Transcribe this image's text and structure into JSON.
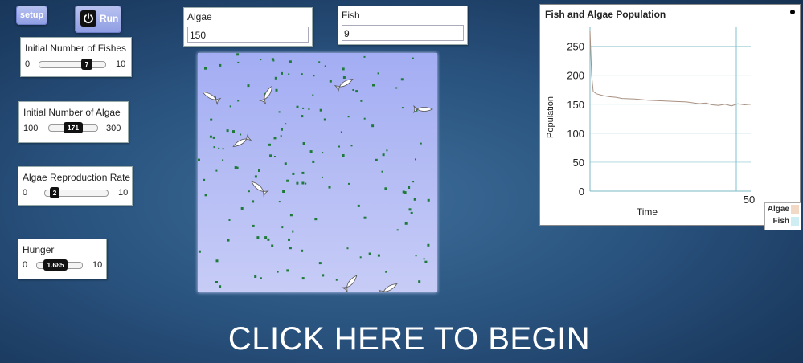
{
  "buttons": {
    "setup": "setup",
    "run": "Run"
  },
  "sliders": [
    {
      "title": "Initial Number of Fishes",
      "min": "0",
      "max": "10",
      "value": "7",
      "fraction": 0.7
    },
    {
      "title": "Initial Number of Algae",
      "min": "100",
      "max": "300",
      "value": "171",
      "fraction": 0.355
    },
    {
      "title": "Algae Reproduction Rate",
      "min": "0",
      "max": "10",
      "value": "2",
      "fraction": 0.2
    },
    {
      "title": "Hunger",
      "min": "0",
      "max": "10",
      "value": "1.685",
      "fraction": 0.1685
    }
  ],
  "monitors": {
    "algae": {
      "label": "Algae",
      "value": "150"
    },
    "fish": {
      "label": "Fish",
      "value": "9"
    }
  },
  "plot": {
    "title": "Fish and Algae Population",
    "ylabel": "Population",
    "xlabel": "Time",
    "yticks": [
      "250",
      "200",
      "150",
      "100",
      "50",
      "0"
    ],
    "xmax_label": "50"
  },
  "legend": [
    {
      "name": "Algae",
      "color": "#f1d9c6"
    },
    {
      "name": "Fish",
      "color": "#cfeef3"
    }
  ],
  "chart_data": {
    "type": "line",
    "title": "Fish and Algae Population",
    "xlabel": "Time",
    "ylabel": "Population",
    "xlim": [
      0,
      50
    ],
    "ylim": [
      0,
      280
    ],
    "series": [
      {
        "name": "Algae",
        "color": "#a89080",
        "x": [
          0,
          0.5,
          1,
          2,
          4,
          6,
          8,
          10,
          14,
          18,
          22,
          26,
          30,
          34,
          36,
          38,
          40,
          42,
          44,
          46,
          48,
          50
        ],
        "values": [
          276,
          200,
          172,
          168,
          165,
          163,
          162,
          160,
          159,
          157,
          156,
          155,
          154,
          151,
          152,
          149,
          148,
          150,
          147,
          151,
          149,
          150
        ]
      },
      {
        "name": "Fish",
        "color": "#7fc2cc",
        "x": [
          0,
          10,
          20,
          30,
          40,
          50
        ],
        "values": [
          9,
          9,
          9,
          9,
          9,
          9
        ]
      }
    ]
  },
  "world": {
    "background": "#b3bbf4"
  },
  "cta": "CLICK HERE TO BEGIN"
}
